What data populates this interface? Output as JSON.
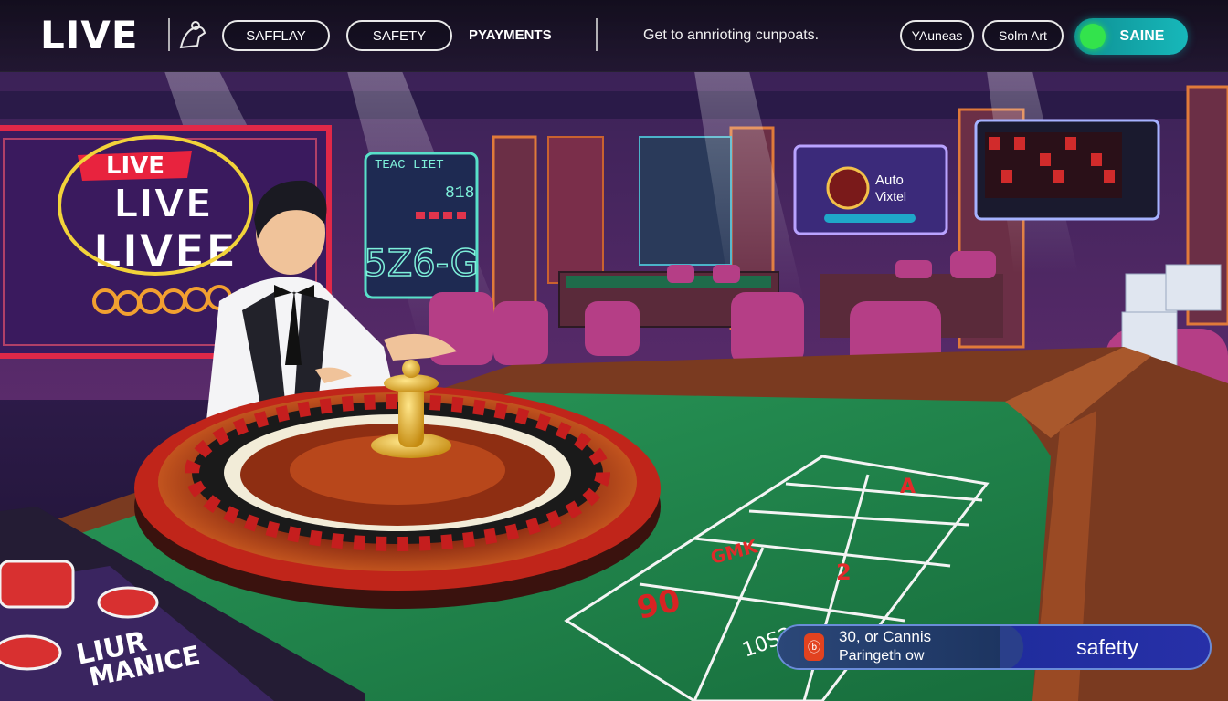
{
  "header": {
    "logo": "LIVE",
    "nav": {
      "saffplay": "SAFFLAY",
      "safety": "SAFETY",
      "payments": "PYAYMENTS"
    },
    "promo_text": "Get to annrioting cunpoats.",
    "buttons": {
      "yauneas": "YAuneas",
      "solm_art": "Solm Art",
      "saine": "SAINE"
    }
  },
  "scene": {
    "left_screen": {
      "line1": "LIVE",
      "line2": "LIVE",
      "line3": "LIVEE"
    },
    "board": {
      "title": "TEAC LIET",
      "number": "818",
      "big": "5Z6-G"
    },
    "right_screen": {
      "line1": "Auto",
      "line2": "Vixtel"
    },
    "table_labels": {
      "a": "A",
      "big_number": "90",
      "cell": "2",
      "small": "10S2",
      "mid": "GMK"
    },
    "bottom_left_card": {
      "line1": "LIUR",
      "line2": "MANICE"
    }
  },
  "bottom_bar": {
    "line1": "30, or Cannis",
    "line2": "Paringeth ow",
    "action": "safetty"
  },
  "colors": {
    "accent_teal": "#17b8ba",
    "status_green": "#33e34c",
    "felt_green": "#1f7d4a",
    "wheel_red": "#c0251a"
  }
}
